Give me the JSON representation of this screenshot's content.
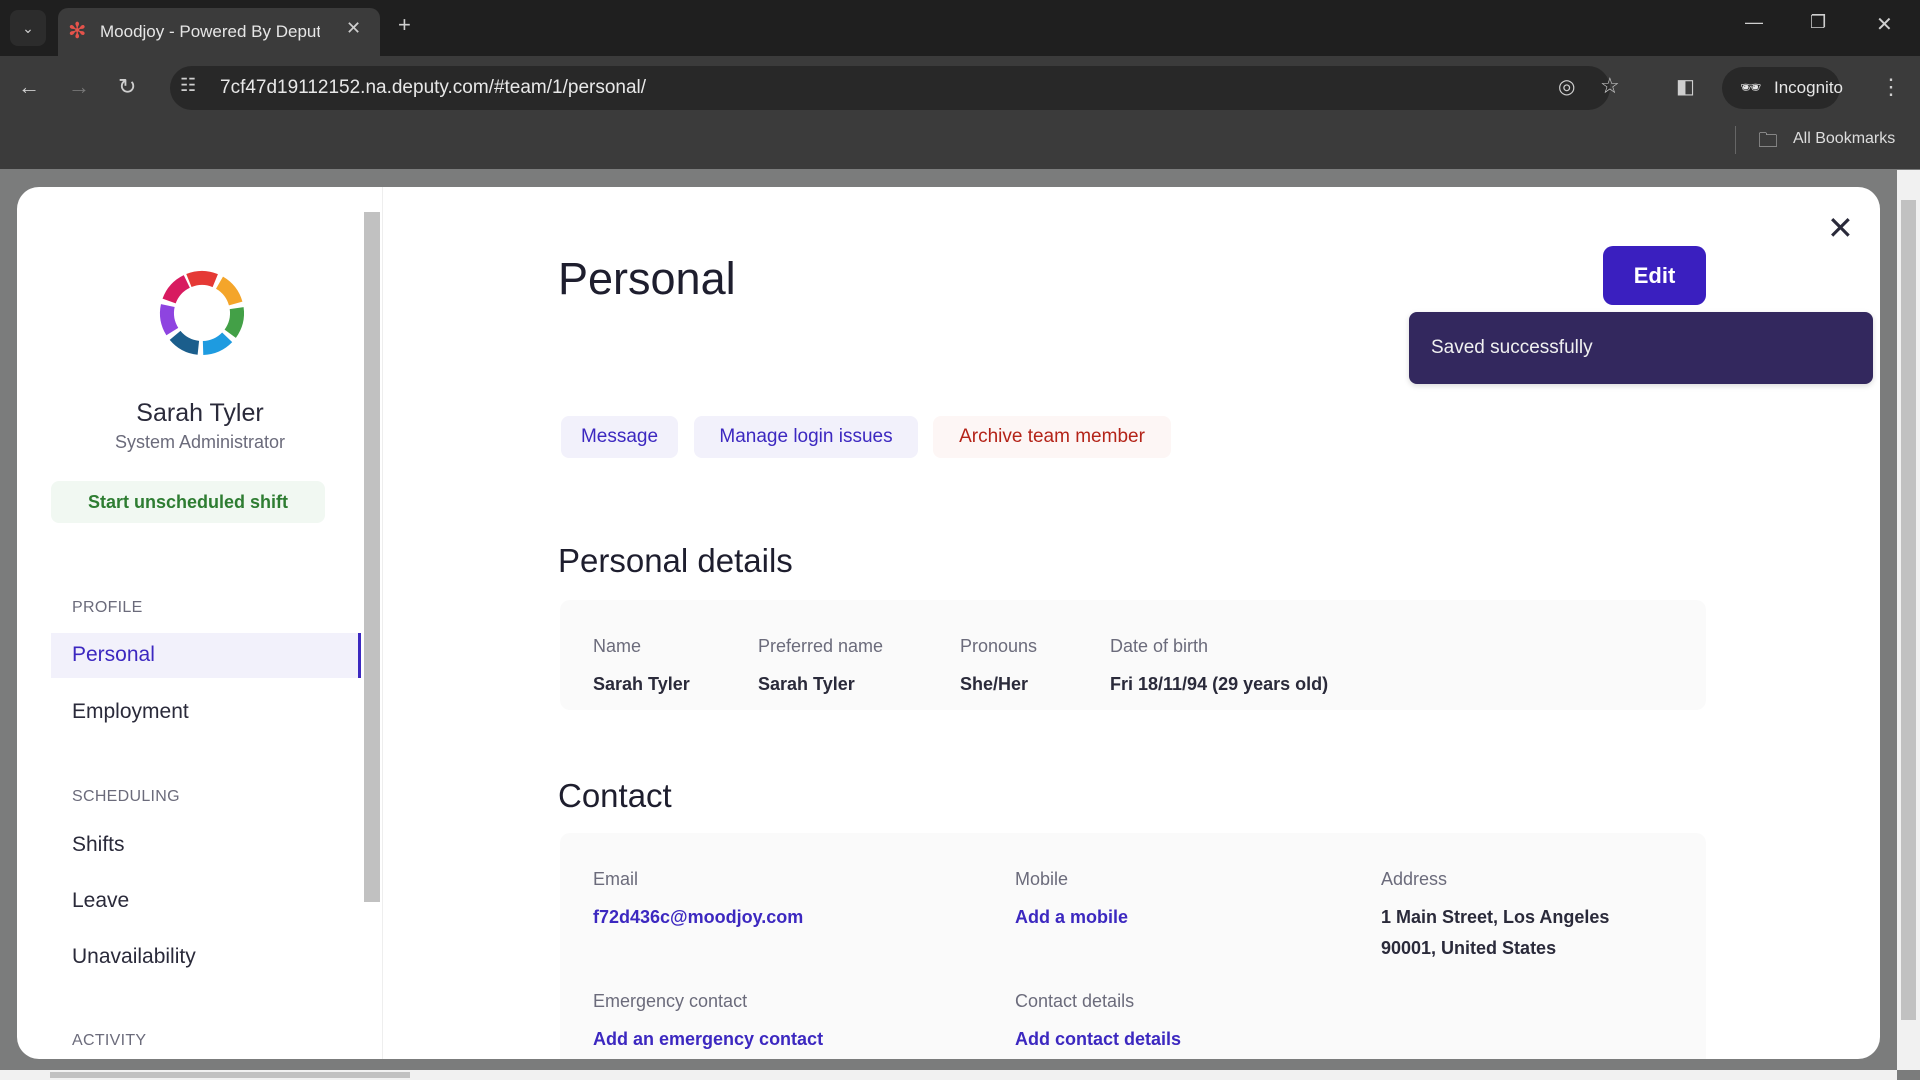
{
  "browser": {
    "tab_title": "Moodjoy - Powered By Deputy",
    "url": "7cf47d19112152.na.deputy.com/#team/1/personal/",
    "incognito_label": "Incognito",
    "bookmarks_label": "All Bookmarks"
  },
  "sidebar": {
    "user_name": "Sarah Tyler",
    "user_role": "System Administrator",
    "start_shift": "Start unscheduled shift",
    "sections": [
      {
        "title": "PROFILE",
        "items": [
          "Personal",
          "Employment"
        ]
      },
      {
        "title": "SCHEDULING",
        "items": [
          "Shifts",
          "Leave",
          "Unavailability"
        ]
      },
      {
        "title": "ACTIVITY",
        "items": []
      }
    ],
    "selected": "Personal"
  },
  "main": {
    "title": "Personal",
    "edit_label": "Edit",
    "toast": "Saved successfully",
    "actions": {
      "message": "Message",
      "manage_login": "Manage login issues",
      "archive": "Archive team member"
    },
    "personal_details": {
      "heading": "Personal details",
      "fields": [
        {
          "label": "Name",
          "value": "Sarah Tyler"
        },
        {
          "label": "Preferred name",
          "value": "Sarah Tyler"
        },
        {
          "label": "Pronouns",
          "value": "She/Her"
        },
        {
          "label": "Date of birth",
          "value": "Fri 18/11/94 (29 years old)"
        }
      ]
    },
    "contact": {
      "heading": "Contact",
      "email_label": "Email",
      "email": "f72d436c@moodjoy.com",
      "mobile_label": "Mobile",
      "mobile": "Add a mobile",
      "address_label": "Address",
      "address_line1": "1 Main Street, Los Angeles",
      "address_line2": "90001, United States",
      "emergency_label": "Emergency contact",
      "emergency": "Add an emergency contact",
      "details_label": "Contact details",
      "details": "Add contact details"
    }
  },
  "colors": {
    "accent": "#3c28c0",
    "toast_bg": "#33285e",
    "danger": "#b42318",
    "success": "#2e7d32"
  }
}
